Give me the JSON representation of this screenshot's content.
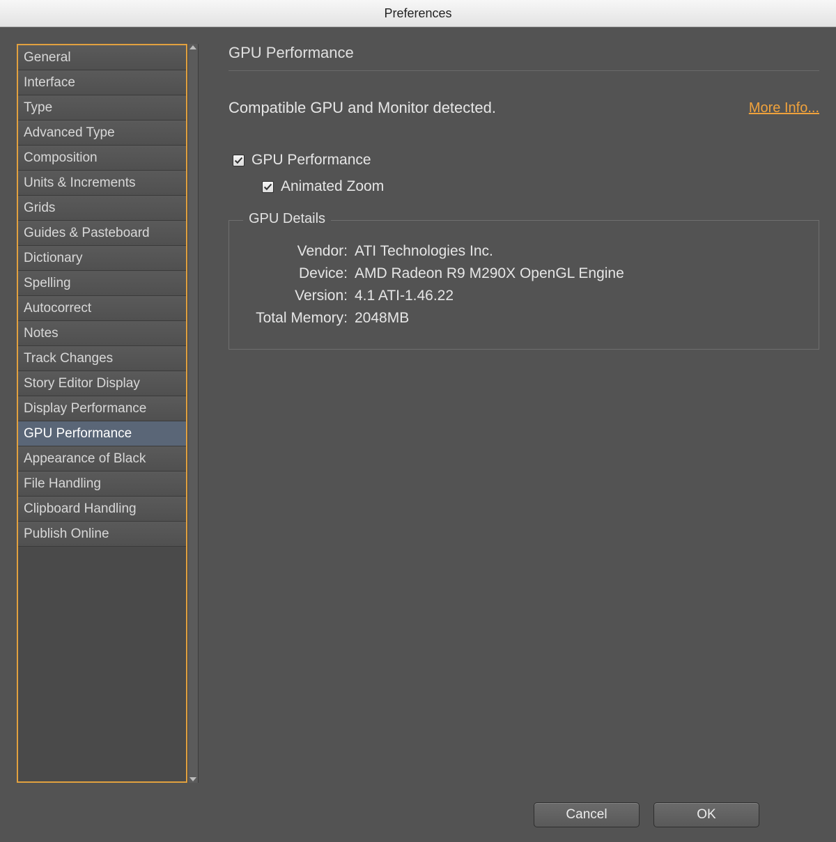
{
  "window": {
    "title": "Preferences"
  },
  "sidebar": {
    "items": [
      {
        "label": "General"
      },
      {
        "label": "Interface"
      },
      {
        "label": "Type"
      },
      {
        "label": "Advanced Type"
      },
      {
        "label": "Composition"
      },
      {
        "label": "Units & Increments"
      },
      {
        "label": "Grids"
      },
      {
        "label": "Guides & Pasteboard"
      },
      {
        "label": "Dictionary"
      },
      {
        "label": "Spelling"
      },
      {
        "label": "Autocorrect"
      },
      {
        "label": "Notes"
      },
      {
        "label": "Track Changes"
      },
      {
        "label": "Story Editor Display"
      },
      {
        "label": "Display Performance"
      },
      {
        "label": "GPU Performance"
      },
      {
        "label": "Appearance of Black"
      },
      {
        "label": "File Handling"
      },
      {
        "label": "Clipboard Handling"
      },
      {
        "label": "Publish Online"
      }
    ],
    "selected_index": 15
  },
  "panel": {
    "title": "GPU Performance",
    "status_text": "Compatible GPU and Monitor detected.",
    "more_info_label": "More Info...",
    "checkbox_gpu": {
      "label": "GPU Performance",
      "checked": true
    },
    "checkbox_zoom": {
      "label": "Animated Zoom",
      "checked": true
    },
    "details": {
      "legend": "GPU Details",
      "vendor_label": "Vendor:",
      "vendor_value": "ATI Technologies Inc.",
      "device_label": "Device:",
      "device_value": "AMD Radeon R9 M290X OpenGL Engine",
      "version_label": "Version:",
      "version_value": "4.1 ATI-1.46.22",
      "memory_label": "Total Memory:",
      "memory_value": "2048MB"
    }
  },
  "buttons": {
    "cancel": "Cancel",
    "ok": "OK"
  },
  "colors": {
    "accent": "#e2a13f",
    "link": "#f0a23c"
  }
}
